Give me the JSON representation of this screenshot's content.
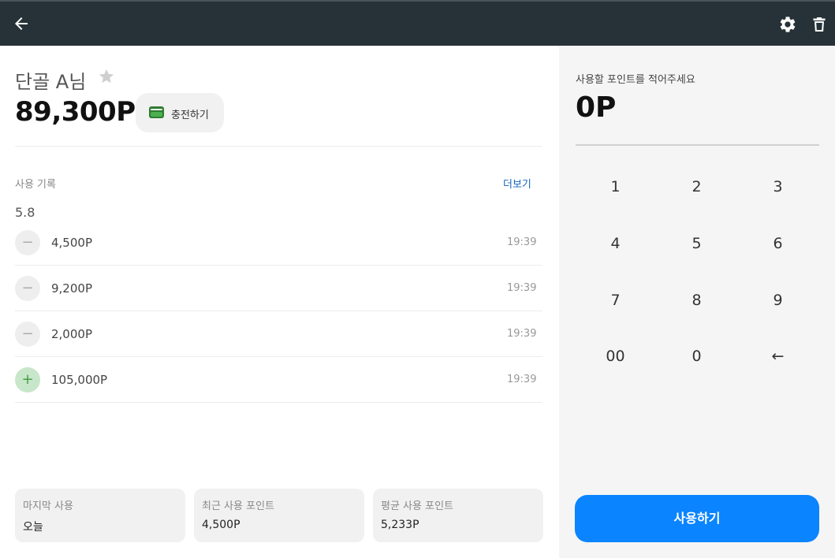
{
  "toolbar": {
    "back_icon": "arrow-left-icon",
    "settings_icon": "gear-icon",
    "delete_icon": "trash-icon"
  },
  "customer": {
    "name": "단골 A님",
    "balance": "89,300P",
    "charge_label": "충전하기",
    "favorite_icon": "star-icon",
    "wallet_icon": "wallet-icon"
  },
  "history": {
    "title": "사용 기록",
    "more_label": "더보기",
    "date": "5.8",
    "items": [
      {
        "type": "minus",
        "sign": "−",
        "amount": "4,500P",
        "time": "19:39"
      },
      {
        "type": "minus",
        "sign": "−",
        "amount": "9,200P",
        "time": "19:39"
      },
      {
        "type": "minus",
        "sign": "−",
        "amount": "2,000P",
        "time": "19:39"
      },
      {
        "type": "plus",
        "sign": "+",
        "amount": "105,000P",
        "time": "19:39"
      }
    ]
  },
  "stats": [
    {
      "title": "마지막 사용",
      "value": "오늘"
    },
    {
      "title": "최근 사용 포인트",
      "value": "4,500P"
    },
    {
      "title": "평균 사용 포인트",
      "value": "5,233P"
    }
  ],
  "input": {
    "prompt": "사용할 포인트를 적어주세요",
    "value": "0P"
  },
  "keypad": [
    "1",
    "2",
    "3",
    "4",
    "5",
    "6",
    "7",
    "8",
    "9",
    "00",
    "0",
    "←"
  ],
  "use_button": "사용하기",
  "colors": {
    "topbar": "#263238",
    "accent": "#0a84ff",
    "link": "#1565c0",
    "plus_badge": "#c8e6c9",
    "wallet": "#2e7d32"
  }
}
